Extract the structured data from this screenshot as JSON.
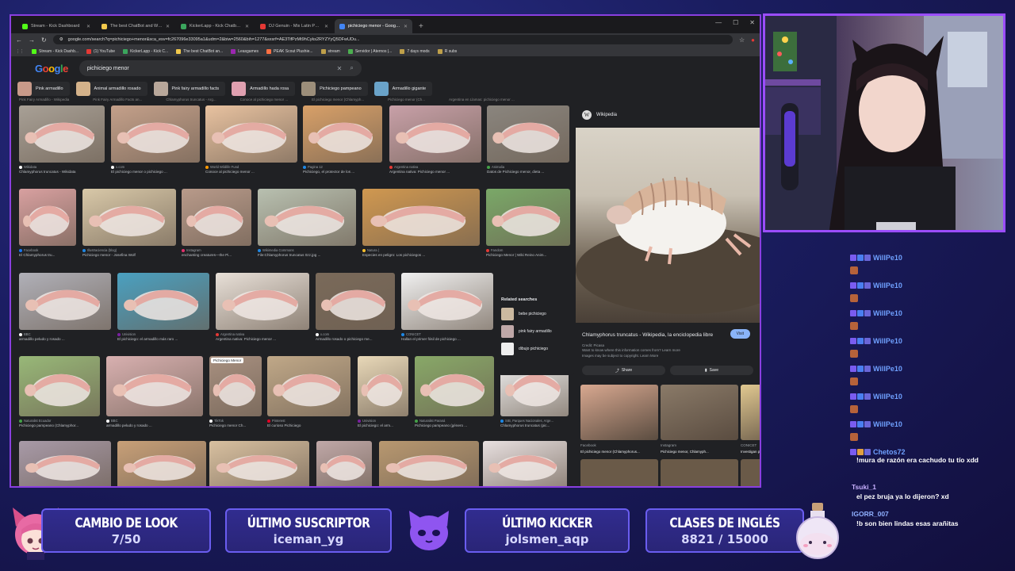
{
  "browser": {
    "tabs": [
      {
        "label": "Stream - Kick Dashboard",
        "color": "#53fc18"
      },
      {
        "label": "The best ChatBot and Widgets for K...",
        "color": "#f2c94c"
      },
      {
        "label": "KickerLapp - Kick Chatbot and Over...",
        "color": "#3ba55d"
      },
      {
        "label": "DJ Genuin - Mix Latin Pop (Tierra...",
        "color": "#e53935"
      },
      {
        "label": "pichiciego menor - Google Sear...",
        "color": "#4285f4",
        "active": true
      }
    ],
    "url": "google.com/search?q=pichiciego+menor&sca_esv=fc267096e33095a1&udm=2&biw=2560&bih=1277&sxsrf=AE3TifPzMt9hCyks2RYZYyQ5DFwUDu...",
    "bookmarks": [
      "Stream - Kick Dashb...",
      "(1) YouTube",
      "KickerLapp - Kick C...",
      "The best ChatBot an...",
      "Leasgames",
      "PEAK Scout Plushie...",
      "stream",
      "Servidor | Aternos |...",
      "7 days mods",
      "R subs"
    ]
  },
  "google": {
    "logo": "Google",
    "query": "pichiciego menor",
    "chips": [
      {
        "label": "Pink armadillo",
        "color": "#c89a8a"
      },
      {
        "label": "Animal armadillo rosado",
        "color": "#d4b28a"
      },
      {
        "label": "Pink fairy armadillo facts",
        "color": "#b8a79a"
      },
      {
        "label": "Armadillo hada rosa",
        "color": "#e0a0b0"
      },
      {
        "label": "Pichiciego pampeano",
        "color": "#9c8e7a"
      },
      {
        "label": "Armadillo gigante",
        "color": "#6aa3c9"
      }
    ],
    "strip": [
      "Pink Fairy Armadillo - Wikipedia",
      "Pink Fairy Armadillo Facts an...",
      "Chlamyphorus truncatus - Arg...",
      "Conoce al pichiciego menor ...",
      "El pichiciego menor (Chlamyph...",
      "Pichiciego menor (Ch...",
      "Argentina en Llamas: pichiciego menor ..."
    ],
    "results": [
      {
        "src": "Wikidata",
        "title": "Chlamyphorus truncatus - Wikidata",
        "color": "#a8a096",
        "srcColor": "#ffffff"
      },
      {
        "src": "x.com",
        "title": "El pichiciego menor o pichiciego ...",
        "color": "#c4a08a",
        "srcColor": "#ffffff"
      },
      {
        "src": "World Wildlife Fund",
        "title": "Conoce al pichiciego menor ...",
        "color": "#e8c2a0",
        "srcColor": "#ff9900"
      },
      {
        "src": "Pagina 12",
        "title": "Pichiciego, el protector de los ...",
        "color": "#d8a068",
        "srcColor": "#1e88e5"
      },
      {
        "src": "Argentina nativa",
        "title": "Argentina nativa: Pichiciego menor ...",
        "color": "#c8a0a8",
        "srcColor": "#e53935"
      },
      {
        "src": "Animalia",
        "title": "Datos de Pichiciego menor, dieta ...",
        "color": "#8a857e",
        "srcColor": "#43a047"
      },
      {
        "src": "Facebook",
        "title": "El Chlamyphorus tru...",
        "color": "#d8a0a0",
        "srcColor": "#1877f2"
      },
      {
        "src": "Illustraciencia (blog)",
        "title": "Pichiciego menor - Josefina Wolf",
        "color": "#d8c8a8",
        "srcColor": "#1e88e5"
      },
      {
        "src": "Instagram",
        "title": "enchanting creatures—the Pi...",
        "color": "#b89a8a",
        "srcColor": "#e1306c"
      },
      {
        "src": "Wikimedia Commons",
        "title": "File:Chlamyphorus truncatus 0zz.jpg ...",
        "color": "#b8c0b0",
        "srcColor": "#1e88e5"
      },
      {
        "src": "Natura |",
        "title": "Especies en peligro: Los pichiciegos ...",
        "color": "#d09850",
        "srcColor": "#fbc02d"
      },
      {
        "src": "Fandom",
        "title": "Pichiciego Menor | Wiki Reino Anim...",
        "color": "#7aa868",
        "srcColor": "#e53935"
      },
      {
        "src": "BBC",
        "title": "armadillo peludo y rosado ...",
        "color": "#b0b0b8",
        "srcColor": "#ffffff"
      },
      {
        "src": "Univision",
        "title": "El pichiciego: el armadillo más raro ...",
        "color": "#4aa0c0",
        "srcColor": "#7b1fa2"
      },
      {
        "src": "Argentina nativa",
        "title": "Argentina nativa: Pichiciego menor ...",
        "color": "#e8e0d8",
        "srcColor": "#e53935"
      },
      {
        "src": "x.com",
        "title": "Armadillo rosado o pichiciego me...",
        "color": "#7a6a5a",
        "srcColor": "#ffffff"
      },
      {
        "src": "CONICET",
        "title": "Hallan el primer fósil de pichiciego ...",
        "color": "#f0f0f0",
        "srcColor": "#1e88e5"
      },
      {
        "src": "Naturalist Ecuador",
        "title": "Pichiciego pampeano (Chlamyphor...",
        "color": "#98b878",
        "srcColor": "#43a047"
      },
      {
        "src": "BBC",
        "title": "armadillo peludo y rosado ...",
        "color": "#d8b0b0",
        "srcColor": "#ffffff"
      },
      {
        "src": "TikTok",
        "title": "Pichiciego menor Ch...",
        "color": "#a89080",
        "srcColor": "#ffffff"
      },
      {
        "src": "Pinterest",
        "title": "El curioso Pichiciego",
        "color": "#c0a888",
        "srcColor": "#e60023"
      },
      {
        "src": "Univision",
        "title": "El pichiciego: el arm...",
        "color": "#e8d8b8",
        "srcColor": "#7b1fa2"
      },
      {
        "src": "Naturalist Paraná",
        "title": "Pichiciego pampeano (género ...",
        "color": "#88a868",
        "srcColor": "#43a047"
      },
      {
        "src": "SIB, Parques Nacionales, Arge...",
        "title": "Chlamyphorus truncatus (pic...",
        "color": "#f4f4f4",
        "srcColor": "#1e88e5"
      },
      {
        "src": "",
        "title": "",
        "color": "#a89aa8",
        "srcColor": "#ffffff"
      },
      {
        "src": "",
        "title": "",
        "color": "#c8a078",
        "srcColor": "#ffffff"
      },
      {
        "src": "",
        "title": "",
        "color": "#d8c0a0",
        "srcColor": "#ffffff"
      },
      {
        "src": "",
        "title": "",
        "color": "#c0a8a8",
        "srcColor": "#ffffff"
      },
      {
        "src": "",
        "title": "",
        "color": "#b89870",
        "srcColor": "#ffffff"
      },
      {
        "src": "",
        "title": "",
        "color": "#e8e0e0",
        "srcColor": "#ffffff"
      }
    ],
    "tiktok_badge": "Pichiciego Menor",
    "related": {
      "title": "Related searches",
      "items": [
        "bebe pichiciego",
        "pink fairy armadillo",
        "dibujo pichiciego"
      ]
    },
    "panel": {
      "source": "Wikipedia",
      "title": "Chlamyphorus truncatus - Wikipedia, la enciclopedia libre",
      "visit": "Visit",
      "credit": "Credit: Picasa",
      "notice1": "Want to know where this information comes from? Learn more",
      "notice2": "Images may be subject to copyright. Learn More",
      "share": "Share",
      "save": "Save",
      "thumbs": [
        {
          "src": "Facebook",
          "title": "El pichiciego menor (Chlamyphorus...",
          "color": "#d8a890"
        },
        {
          "src": "Instagram",
          "title": "Pichiciego menor, Chlamyph...",
          "color": "#8a7a68"
        },
        {
          "src": "CONICET",
          "title": "Investigan por primera vez la doble cap...",
          "color": "#e0c890"
        }
      ]
    }
  },
  "chat": [
    {
      "user": "WillPe10",
      "msg": ""
    },
    {
      "user": "WillPe10",
      "msg": ""
    },
    {
      "user": "WillPe10",
      "msg": ""
    },
    {
      "user": "WillPe10",
      "msg": ""
    },
    {
      "user": "WillPe10",
      "msg": ""
    },
    {
      "user": "WillPe10",
      "msg": ""
    },
    {
      "user": "WillPe10",
      "msg": ""
    },
    {
      "user": "Chetos72",
      "msg": "!mura de razón era cachudo tu tío xdd"
    },
    {
      "user": "Tsuki_1",
      "msg": "el pez bruja ya lo dijeron? xd"
    },
    {
      "user": "IGORR_007",
      "msg": "!b son bien lindas esas arañitas"
    }
  ],
  "overlay": {
    "cards": [
      {
        "title": "CAMBIO DE LOOK",
        "value": "7/50"
      },
      {
        "title": "ÚLTIMO SUSCRIPTOR",
        "value": "iceman_yg"
      },
      {
        "title": "ÚLTIMO KICKER",
        "value": "jolsmen_aqp"
      },
      {
        "title": "CLASES DE INGLÉS",
        "value": "8821 / 15000"
      }
    ],
    "accent": "#9b4dff"
  }
}
